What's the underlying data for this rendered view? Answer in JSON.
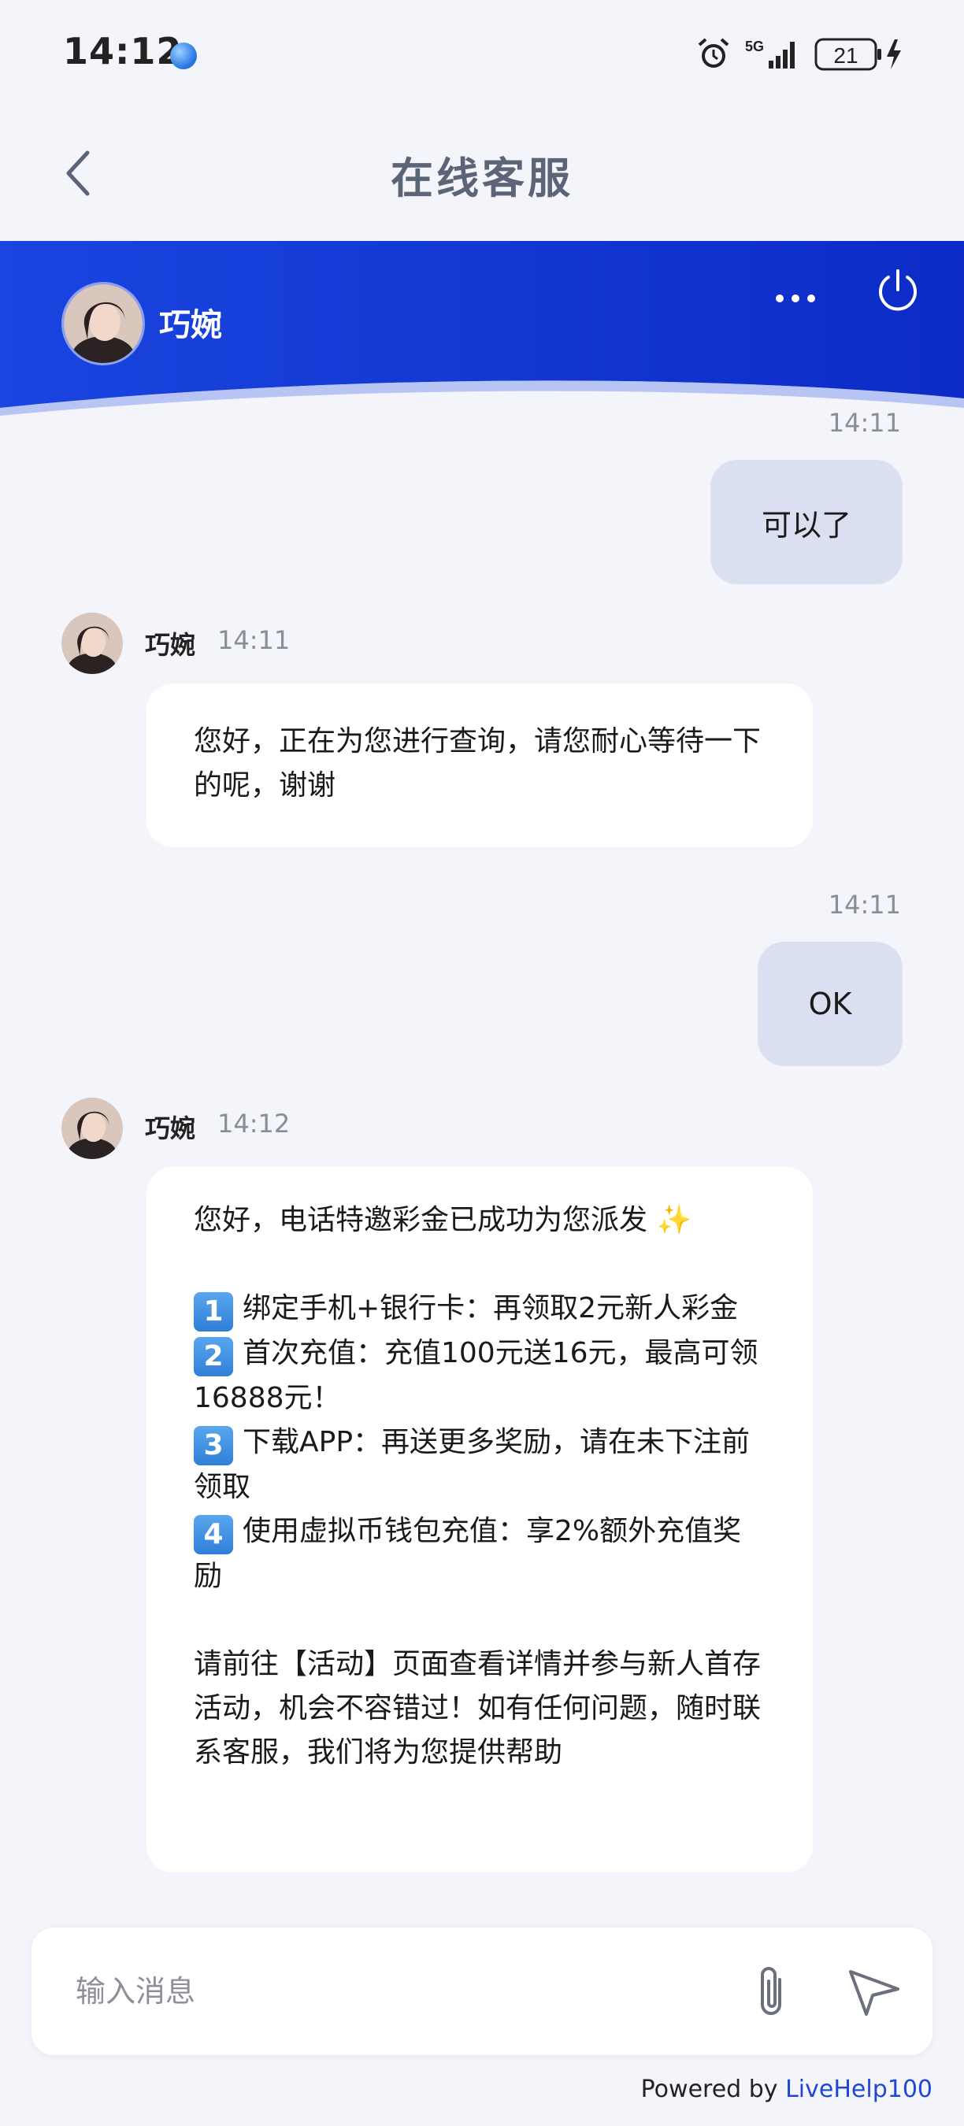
{
  "status_bar": {
    "time": "14:12",
    "network": "5G",
    "battery": "21"
  },
  "header": {
    "title": "在线客服"
  },
  "agent": {
    "name": "巧婉"
  },
  "messages": [
    {
      "side": "right",
      "time": "14:11",
      "text": "可以了"
    },
    {
      "side": "left",
      "name": "巧婉",
      "time": "14:11",
      "text": "您好，正在为您进行查询，请您耐心等待一下的呢，谢谢"
    },
    {
      "side": "right",
      "time": "14:11",
      "text": "OK"
    },
    {
      "side": "left",
      "name": "巧婉",
      "time": "14:12",
      "intro": "您好，电话特邀彩金已成功为您派发 ✨",
      "items": [
        {
          "num": "1",
          "text": "绑定手机+银行卡：再领取2元新人彩金"
        },
        {
          "num": "2",
          "text": "首次充值：充值100元送16元，最高可领16888元！"
        },
        {
          "num": "3",
          "text": "下载APP：再送更多奖励，请在未下注前领取"
        },
        {
          "num": "4",
          "text": "使用虚拟币钱包充值：享2%额外充值奖励"
        }
      ],
      "outro": "请前往【活动】页面查看详情并参与新人首存活动，机会不容错过！如有任何问题，随时联系客服，我们将为您提供帮助"
    }
  ],
  "input": {
    "placeholder": "输入消息"
  },
  "footer": {
    "powered_by": "Powered by ",
    "brand": "LiveHelp100"
  },
  "colors": {
    "header_blue": "#1238d8",
    "bubble_right": "#dadff2",
    "bubble_left": "#ffffff",
    "brand": "#1f47d6"
  }
}
